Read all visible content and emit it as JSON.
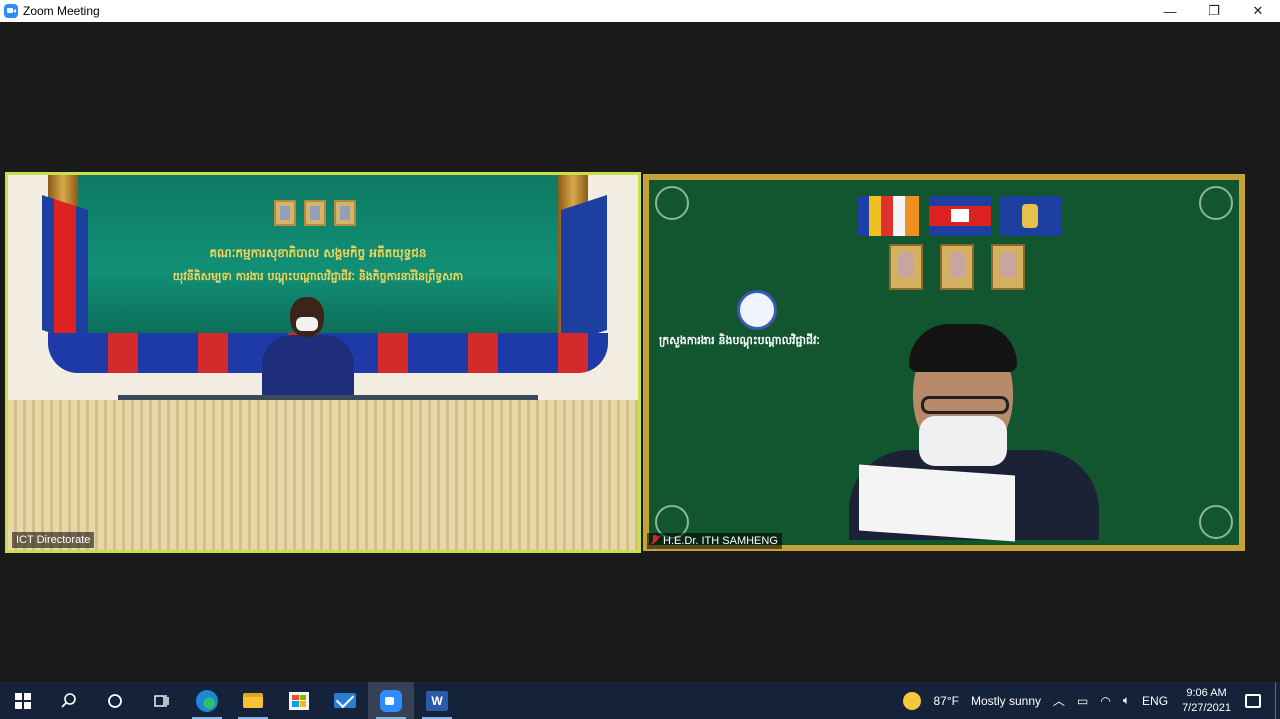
{
  "window": {
    "title": "Zoom Meeting",
    "controls": {
      "minimize": "—",
      "restore": "❐",
      "close": "✕"
    }
  },
  "participants": [
    {
      "name": "ICT Directorate",
      "active_speaker": true,
      "muted": false
    },
    {
      "name": "H.E.Dr. ITH SAMHENG",
      "active_speaker": false,
      "muted": true
    }
  ],
  "left_video": {
    "banner_line1": "គណៈកម្មការសុខាភិបាល សង្គមកិច្ច អតីតយុទ្ធជន",
    "banner_line2": "យុវនីតិសម្បទា ការងារ បណ្តុះបណ្តាលវិជ្ជាជីវៈ និងកិច្ចការនារីនៃព្រឹទ្ធសភា"
  },
  "right_video": {
    "ministry_label": "ក្រសួងការងារ និងបណ្តុះបណ្តាលវិជ្ជាជីវៈ"
  },
  "taskbar": {
    "apps": [
      {
        "name": "start",
        "running": false
      },
      {
        "name": "search",
        "running": false
      },
      {
        "name": "cortana",
        "running": false
      },
      {
        "name": "task-view",
        "running": false
      },
      {
        "name": "edge",
        "running": true
      },
      {
        "name": "file-explorer",
        "running": true
      },
      {
        "name": "store",
        "running": false
      },
      {
        "name": "mail",
        "running": false
      },
      {
        "name": "zoom",
        "running": true,
        "active": true
      },
      {
        "name": "word",
        "running": true
      }
    ],
    "weather_temp": "87°F",
    "weather_desc": "Mostly sunny",
    "language": "ENG",
    "time": "9:06 AM",
    "date": "7/27/2021"
  }
}
